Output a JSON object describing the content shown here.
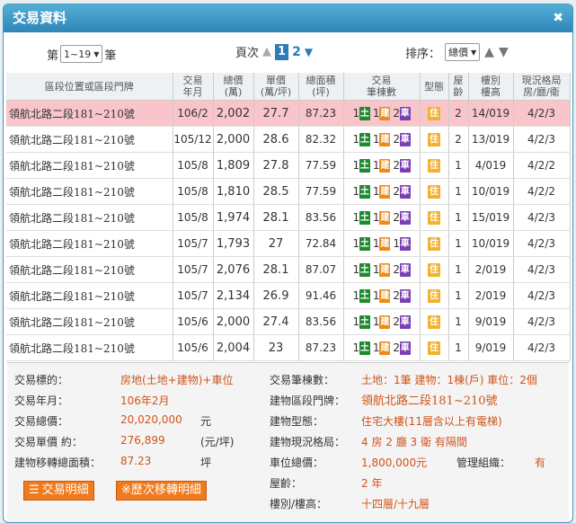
{
  "title": "交易資料",
  "close_glyph": "✖",
  "row_range": {
    "prefix": "第",
    "selected": "1~19",
    "suffix": "筆"
  },
  "pagination": {
    "label": "頁次",
    "current": "1",
    "next": "2"
  },
  "sort": {
    "label": "排序：",
    "selected": "總價"
  },
  "headers": {
    "addr": "區段位置或區段門牌",
    "date": [
      "交易",
      "年月"
    ],
    "total": [
      "總價",
      "(萬)"
    ],
    "unit": [
      "單價",
      "(萬/坪)"
    ],
    "area": [
      "總面積",
      "(坪)"
    ],
    "units": [
      "交易",
      "筆棟數"
    ],
    "type": "型態",
    "age": [
      "屋",
      "齡"
    ],
    "floor": [
      "樓別",
      "樓高"
    ],
    "layout": [
      "現況格局",
      "房/廳/衛"
    ]
  },
  "badges": {
    "land": "土",
    "building": "建",
    "car": "車",
    "type": "住"
  },
  "rows": [
    {
      "addr": "領航北路二段181~210號",
      "date": "106/2",
      "total": "2,002",
      "unit": "27.7",
      "area": "87.23",
      "land": "1",
      "bldg": "1",
      "car": "2",
      "age": "2",
      "floor": "14/019",
      "layout": "4/2/3",
      "highlight": true
    },
    {
      "addr": "領航北路二段181~210號",
      "date": "105/12",
      "total": "2,000",
      "unit": "28.6",
      "area": "82.32",
      "land": "1",
      "bldg": "1",
      "car": "2",
      "age": "2",
      "floor": "13/019",
      "layout": "4/2/3",
      "highlight": false
    },
    {
      "addr": "領航北路二段181~210號",
      "date": "105/8",
      "total": "1,809",
      "unit": "27.8",
      "area": "77.59",
      "land": "1",
      "bldg": "1",
      "car": "2",
      "age": "1",
      "floor": "4/019",
      "layout": "4/2/2",
      "highlight": false
    },
    {
      "addr": "領航北路二段181~210號",
      "date": "105/8",
      "total": "1,810",
      "unit": "28.5",
      "area": "77.59",
      "land": "1",
      "bldg": "1",
      "car": "2",
      "age": "1",
      "floor": "10/019",
      "layout": "4/2/2",
      "highlight": false
    },
    {
      "addr": "領航北路二段181~210號",
      "date": "105/8",
      "total": "1,974",
      "unit": "28.1",
      "area": "83.56",
      "land": "1",
      "bldg": "1",
      "car": "2",
      "age": "1",
      "floor": "15/019",
      "layout": "4/2/3",
      "highlight": false
    },
    {
      "addr": "領航北路二段181~210號",
      "date": "105/7",
      "total": "1,793",
      "unit": "27",
      "area": "72.84",
      "land": "1",
      "bldg": "1",
      "car": "1",
      "age": "1",
      "floor": "10/019",
      "layout": "4/2/3",
      "highlight": false
    },
    {
      "addr": "領航北路二段181~210號",
      "date": "105/7",
      "total": "2,076",
      "unit": "28.1",
      "area": "87.07",
      "land": "1",
      "bldg": "1",
      "car": "2",
      "age": "1",
      "floor": "2/019",
      "layout": "4/2/3",
      "highlight": false
    },
    {
      "addr": "領航北路二段181~210號",
      "date": "105/7",
      "total": "2,134",
      "unit": "26.9",
      "area": "91.46",
      "land": "1",
      "bldg": "1",
      "car": "2",
      "age": "1",
      "floor": "2/019",
      "layout": "4/2/3",
      "highlight": false
    },
    {
      "addr": "領航北路二段181~210號",
      "date": "105/6",
      "total": "2,000",
      "unit": "27.4",
      "area": "83.56",
      "land": "1",
      "bldg": "1",
      "car": "2",
      "age": "1",
      "floor": "9/019",
      "layout": "4/2/3",
      "highlight": false
    },
    {
      "addr": "領航北路二段181~210號",
      "date": "105/6",
      "total": "2,004",
      "unit": "23",
      "area": "87.23",
      "land": "1",
      "bldg": "1",
      "car": "2",
      "age": "1",
      "floor": "9/019",
      "layout": "4/2/3",
      "highlight": false
    }
  ],
  "detail": {
    "target_label": "交易標的：",
    "target_value": "房地(土地+建物)+車位",
    "date_label": "交易年月：",
    "date_value": "106年2月",
    "total_label": "交易總價：",
    "total_value": "20,020,000",
    "total_unit": "元",
    "unit_label": "交易單價 約：",
    "unit_value": "276,899",
    "unit_unit": "(元/坪)",
    "area_label": "建物移轉總面積：",
    "area_value": "87.23",
    "area_unit": "坪",
    "count_label": "交易筆棟數：",
    "count_value": "土地：1筆 建物：1棟(戶) 車位：2個",
    "doorplate_label": "建物區段門牌：",
    "doorplate_value": "領航北路二段181~210號",
    "btype_label": "建物型態：",
    "btype_value": "住宅大樓(11層含以上有電梯)",
    "layout_label": "建物現況格局：",
    "layout_value": "4 房 2 廳 3 衛 有隔間",
    "park_label": "車位總價：",
    "park_value": "1,800,000元",
    "mgmt_label": "管理組織：",
    "mgmt_value": "有",
    "age_label": "屋齡：",
    "age_value": "2 年",
    "floor_label": "樓別/樓高：",
    "floor_value": "十四層/十九層"
  },
  "buttons": {
    "detail": "交易明細",
    "history": "※歷次移轉明細"
  }
}
